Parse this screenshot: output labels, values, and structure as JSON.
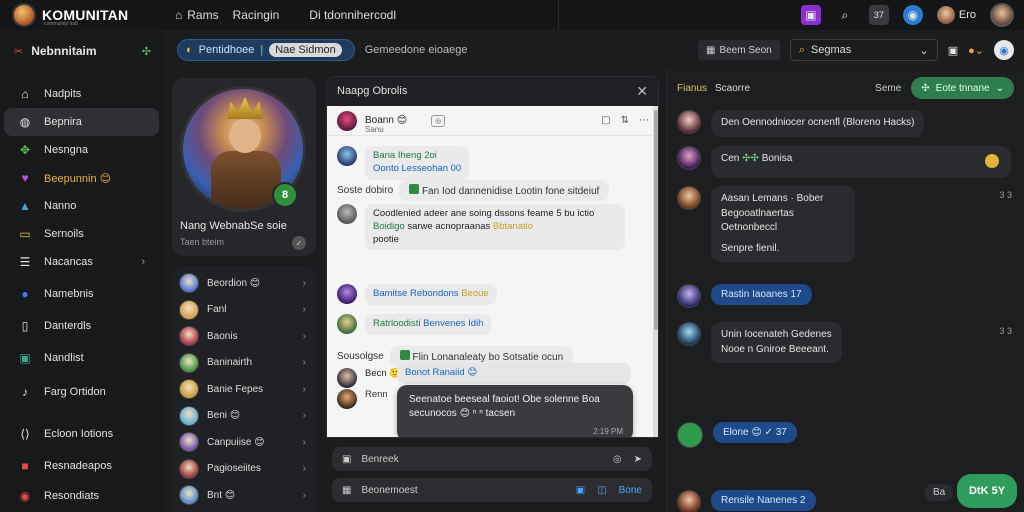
{
  "brand": {
    "name": "KOMUNITAN",
    "tagline": "community hub"
  },
  "topnav": {
    "home": "Rams",
    "feed": "Racingin",
    "search_text": "Di tdonnihercodl"
  },
  "topright": {
    "badge": "37",
    "user_label": "Ero"
  },
  "sidebar": {
    "header": "Nebnnitaim",
    "items": [
      {
        "label": "Nadpits",
        "icon": "home-icon"
      },
      {
        "label": "Bepnira",
        "icon": "group-icon",
        "active": true
      },
      {
        "label": "Nesngna",
        "icon": "handshake-icon"
      },
      {
        "label": "Beepunnin 😊",
        "icon": "heart-icon"
      },
      {
        "label": "Nanno",
        "icon": "chart-icon"
      },
      {
        "label": "Sernoils",
        "icon": "folder-icon"
      },
      {
        "label": "Nacancas",
        "icon": "menu-icon",
        "chevron": true
      },
      {
        "label": "Namebnis",
        "icon": "circle-icon"
      },
      {
        "label": "Danterdls",
        "icon": "book-icon"
      },
      {
        "label": "Nandlist",
        "icon": "image-icon"
      },
      {
        "label": "Farg Ortidon",
        "icon": "music-icon"
      }
    ],
    "footer": [
      {
        "label": "Ecloon Iotions",
        "icon": "code-icon"
      },
      {
        "label": "Resnadeapos",
        "icon": "briefcase-icon"
      },
      {
        "label": "Resondiats",
        "icon": "record-icon"
      }
    ]
  },
  "subheader": {
    "pill_main": "Pentidhoee",
    "pill_alt": "Nae Sidmon",
    "crumb": "Gemeedone eioaege",
    "btn": "Beem Seon",
    "search": "Segmas"
  },
  "profile": {
    "name": "Nang WebnabSe soie",
    "sub": "Taen bteim",
    "badge": "8"
  },
  "friends": [
    {
      "name": "Beordion 😊",
      "color": "#5a7bd8"
    },
    {
      "name": "Fanl",
      "color": "#d8a05a"
    },
    {
      "name": "Baonis",
      "color": "#b04050"
    },
    {
      "name": "Baninairth",
      "color": "#4a9a4a"
    },
    {
      "name": "Banie Fepes",
      "color": "#c8a040"
    },
    {
      "name": "Beni 😊",
      "color": "#6ab0d8"
    },
    {
      "name": "Canpuiise 😊",
      "color": "#7a5ab0"
    },
    {
      "name": "Pagioseiites",
      "color": "#a04040"
    },
    {
      "name": "Bnt 😊",
      "color": "#5a90c8"
    }
  ],
  "chat": {
    "title": "Naapg Obrolis",
    "head_name": "Boann 😊",
    "head_sub": "Sanu",
    "m1_name": "Bana Iheng 2oi",
    "m1_text": "Oonto Lesseohan 00",
    "sys1_pre": "Soste dobiro",
    "sys1_text": "Fan Iod dannenidise Lootin fone sitdeiuf",
    "m2_text": "Coodlenied adeer ane soing dssons feame 5 bu ictio",
    "m2_link": "Boidigo",
    "m2_text2": "sarwe acnopraanas",
    "m2_tail": "Bbtanatio",
    "m2_last": "pootie",
    "m3_name": "Bamitse Rebondons",
    "m3_tag": "Beoue",
    "m4_name": "Ratrloodisti",
    "m4_text": "Benvenes Idih",
    "sys2_pre": "Sousolgse",
    "sys2_text": "Flin Lonanaleaty bo Sotsatie ocun",
    "m5_name": "Becn 🙂",
    "m6_pill": "Bonot Ranaiid 😊",
    "m6_name": "Renn",
    "dark_text": "Seenatoe beeseal faoiot! Obe solenne Boa secunocos 😊 ⁿ ⁿ tacsen",
    "dark_time": "2:19 PM",
    "compose1": "Benreek",
    "compose2": "Beonemoest",
    "compose2_btn": "Bone"
  },
  "feed": {
    "head_a": "Fianus",
    "head_b": "Scaorre",
    "right_label": "Seme",
    "btn": "Eote tnnane",
    "items": [
      {
        "text": "Den Oennodniocer ocnenfl (Bloreno Hacks)"
      },
      {
        "text": "Cen",
        "tail": "Bonisa",
        "meta": ""
      },
      {
        "l1": "Aasan Lemans · Bober",
        "l2": "Begooatlnaertas Oetnonbeccl",
        "l3": "Senpre fienil.",
        "meta": "3 3"
      },
      {
        "btn": "Rastin Iaoanes 17"
      },
      {
        "l1": "Unin Iocenateh Gedenes",
        "l2": "Nooe n Gniroe Beeeant.",
        "meta": "3 3"
      },
      {
        "btn": "Elone 😊 ✓ 37"
      },
      {
        "btn": "Rensile Nanenes 2"
      }
    ],
    "float_btn": "DtK 5Y",
    "mini": "Ba"
  },
  "colors": {
    "accent": "#2e7d4f",
    "blue": "#1f4a8a",
    "bg": "#1b1c1e"
  }
}
